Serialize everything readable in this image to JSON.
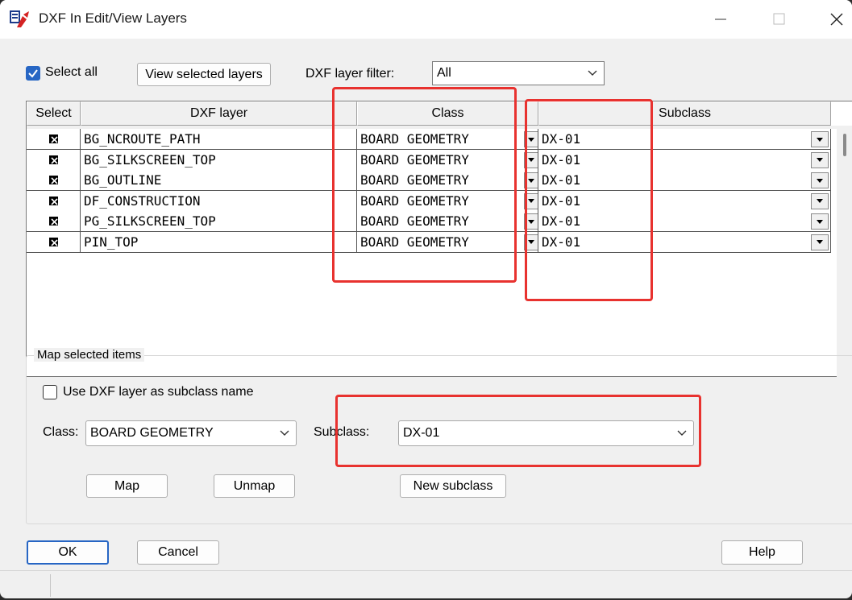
{
  "window": {
    "title": "DXF In Edit/View Layers"
  },
  "toolbar": {
    "select_all_label": "Select all",
    "select_all_checked": true,
    "view_selected_label": "View selected layers",
    "filter_label": "DXF layer filter:",
    "filter_value": "All"
  },
  "grid": {
    "columns": [
      "Select",
      "DXF layer",
      "Class",
      "Subclass"
    ],
    "rows": [
      {
        "selected": true,
        "layer": "BG_NCROUTE_PATH",
        "class": "BOARD GEOMETRY",
        "subclass": "DX-01"
      },
      {
        "selected": true,
        "layer": "BG_SILKSCREEN_TOP",
        "class": "BOARD GEOMETRY",
        "subclass": "DX-01"
      },
      {
        "selected": true,
        "layer": "BG_OUTLINE",
        "class": "BOARD GEOMETRY",
        "subclass": "DX-01"
      },
      {
        "selected": true,
        "layer": "DF_CONSTRUCTION",
        "class": "BOARD GEOMETRY",
        "subclass": "DX-01"
      },
      {
        "selected": true,
        "layer": "PG_SILKSCREEN_TOP",
        "class": "BOARD GEOMETRY",
        "subclass": "DX-01"
      },
      {
        "selected": true,
        "layer": "PIN_TOP",
        "class": "BOARD GEOMETRY",
        "subclass": "DX-01"
      }
    ]
  },
  "map": {
    "group_label": "Map selected items",
    "use_layer_label": "Use DXF layer as subclass name",
    "use_layer_checked": false,
    "class_label": "Class:",
    "class_value": "BOARD GEOMETRY",
    "subclass_label": "Subclass:",
    "subclass_value": "DX-01",
    "map_button": "Map",
    "unmap_button": "Unmap",
    "new_subclass_button": "New subclass"
  },
  "footer": {
    "ok_label": "OK",
    "cancel_label": "Cancel",
    "help_label": "Help"
  },
  "colors": {
    "accent": "#2766c4",
    "highlight": "#e8322f"
  }
}
